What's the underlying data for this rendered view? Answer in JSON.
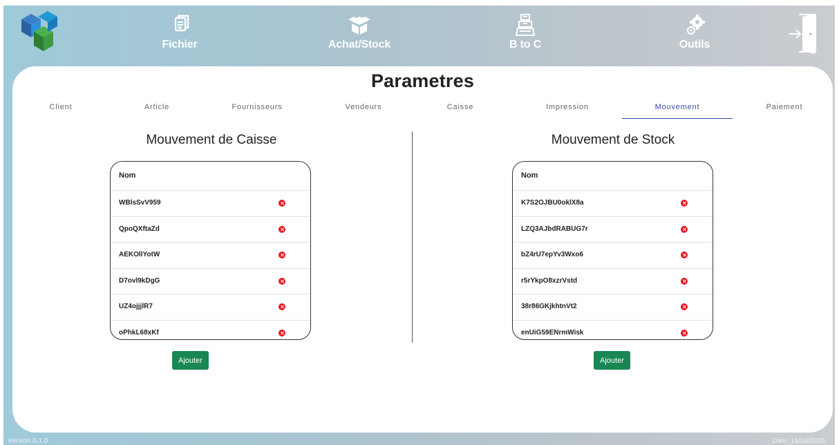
{
  "nav": {
    "items": [
      {
        "label": "Fichier",
        "icon": "document-icon"
      },
      {
        "label": "Achat/Stock",
        "icon": "box-icon"
      },
      {
        "label": "B to C",
        "icon": "cash-register-icon"
      },
      {
        "label": "Outils",
        "icon": "gears-icon"
      }
    ],
    "exit_icon": "exit-door-icon",
    "logo_icon": "app-logo"
  },
  "page": {
    "title": "Parametres"
  },
  "tabs": [
    {
      "label": "Client"
    },
    {
      "label": "Article"
    },
    {
      "label": "Fournisseurs"
    },
    {
      "label": "Vendeurs"
    },
    {
      "label": "Caisse"
    },
    {
      "label": "Impression"
    },
    {
      "label": "Mouvement",
      "active": true
    },
    {
      "label": "Paiement"
    }
  ],
  "caisse": {
    "title": "Mouvement de Caisse",
    "column": "Nom",
    "rows": [
      "WBlsSvV959",
      "QpoQXftaZd",
      "AEKOllYotW",
      "D7ovl9kDgG",
      "UZ4ojjjlR7",
      "oPhkL68xKf"
    ],
    "add_label": "Ajouter"
  },
  "stock": {
    "title": "Mouvement de Stock",
    "column": "Nom",
    "rows": [
      "K7S2OJBU0oklX8a",
      "LZQ3AJbdRABUG7r",
      "bZ4rU7epYv3Wxo6",
      "r5rYkpO8xzrVstd",
      "38r86GKjkhtnVt2",
      "enUiG59ENrmWisk"
    ],
    "add_label": "Ajouter"
  },
  "footer": {
    "version": "Version 0.1.0",
    "date": "Date: 18/04/2025"
  },
  "colors": {
    "accent": "#3949ab",
    "delete": "#e0191f",
    "add_button": "#198754"
  }
}
